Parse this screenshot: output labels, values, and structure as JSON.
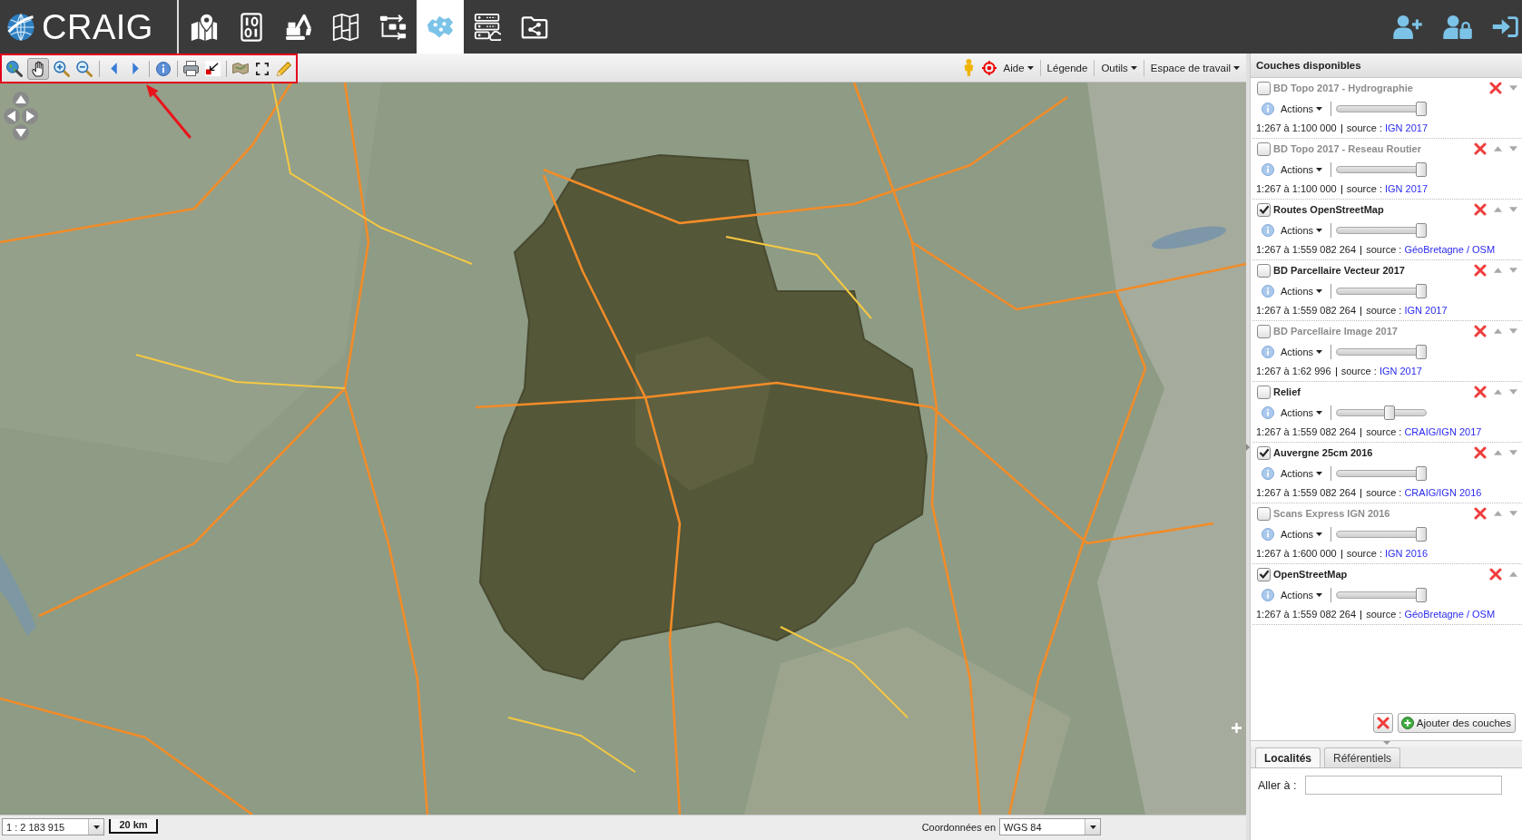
{
  "header": {
    "logo": "CRAIG",
    "nav": [
      {
        "selected": false
      },
      {
        "selected": false
      },
      {
        "selected": false
      },
      {
        "selected": false
      },
      {
        "selected": false
      },
      {
        "selected": true
      },
      {
        "selected": false
      },
      {
        "selected": false
      }
    ]
  },
  "toolbar": {
    "tool_groups": [
      [
        {
          "selected": false
        },
        {
          "selected": true
        },
        {
          "selected": false
        },
        {
          "selected": false
        }
      ],
      [
        {
          "selected": false
        },
        {
          "selected": false
        }
      ],
      [
        {
          "selected": false
        }
      ],
      [
        {
          "selected": false
        },
        {
          "selected": false
        }
      ],
      [
        {
          "selected": false
        },
        {
          "selected": false
        },
        {
          "selected": false
        }
      ]
    ],
    "menus": [
      {
        "label": "Aide",
        "dropdown": true
      },
      {
        "label": "Légende",
        "dropdown": false
      },
      {
        "label": "Outils",
        "dropdown": true
      },
      {
        "label": "Espace de travail",
        "dropdown": true
      }
    ]
  },
  "layers_panel": {
    "title": "Couches disponibles",
    "layers": [
      {
        "name": "BD Topo 2017 - Hydrographie",
        "checked": false,
        "disabled": true,
        "move_up": false,
        "move_down": true,
        "actions": "Actions",
        "level": 1,
        "scale": "1:267 à 1:100 000",
        "source_label": "source :",
        "source": "IGN 2017"
      },
      {
        "name": "BD Topo 2017 - Reseau Routier",
        "checked": false,
        "disabled": true,
        "move_up": true,
        "move_down": true,
        "actions": "Actions",
        "level": 1,
        "scale": "1:267 à 1:100 000",
        "source_label": "source :",
        "source": "IGN 2017"
      },
      {
        "name": "Routes OpenStreetMap",
        "checked": true,
        "disabled": false,
        "move_up": true,
        "move_down": true,
        "actions": "Actions",
        "level": 1,
        "scale": "1:267 à 1:559 082 264",
        "source_label": "source :",
        "source": "GéoBretagne / OSM"
      },
      {
        "name": "BD Parcellaire Vecteur 2017",
        "checked": false,
        "disabled": false,
        "move_up": true,
        "move_down": true,
        "actions": "Actions",
        "level": 1,
        "scale": "1:267 à 1:559 082 264",
        "source_label": "source :",
        "source": "IGN 2017"
      },
      {
        "name": "BD Parcellaire Image 2017",
        "checked": false,
        "disabled": true,
        "move_up": true,
        "move_down": true,
        "actions": "Actions",
        "level": 1,
        "scale": "1:267 à 1:62 996",
        "source_label": "source :",
        "source": "IGN 2017"
      },
      {
        "name": "Relief",
        "checked": false,
        "disabled": false,
        "move_up": true,
        "move_down": true,
        "actions": "Actions",
        "level": 0.6,
        "scale": "1:267 à 1:559 082 264",
        "source_label": "source :",
        "source": "CRAIG/IGN 2017"
      },
      {
        "name": "Auvergne 25cm 2016",
        "checked": true,
        "disabled": false,
        "move_up": true,
        "move_down": true,
        "actions": "Actions",
        "level": 1,
        "scale": "1:267 à 1:559 082 264",
        "source_label": "source :",
        "source": "CRAIG/IGN 2016"
      },
      {
        "name": "Scans Express IGN 2016",
        "checked": false,
        "disabled": true,
        "move_up": true,
        "move_down": true,
        "actions": "Actions",
        "level": 1,
        "scale": "1:267 à 1:600 000",
        "source_label": "source :",
        "source": "IGN 2016"
      },
      {
        "name": "OpenStreetMap",
        "checked": true,
        "disabled": false,
        "move_up": true,
        "move_down": false,
        "actions": "Actions",
        "level": 1,
        "scale": "1:267 à 1:559 082 264",
        "source_label": "source :",
        "source": "GéoBretagne / OSM"
      }
    ],
    "add_button": "Ajouter des couches"
  },
  "search_panel": {
    "tabs": [
      {
        "label": "Localités",
        "selected": true
      },
      {
        "label": "Référentiels",
        "selected": false
      }
    ],
    "goto_label": "Aller à :"
  },
  "status_bar": {
    "scale": "1 : 2 183 915",
    "scale_bar": "20 km",
    "coords_label": "Coordonnées en",
    "coords_system": "WGS 84"
  }
}
